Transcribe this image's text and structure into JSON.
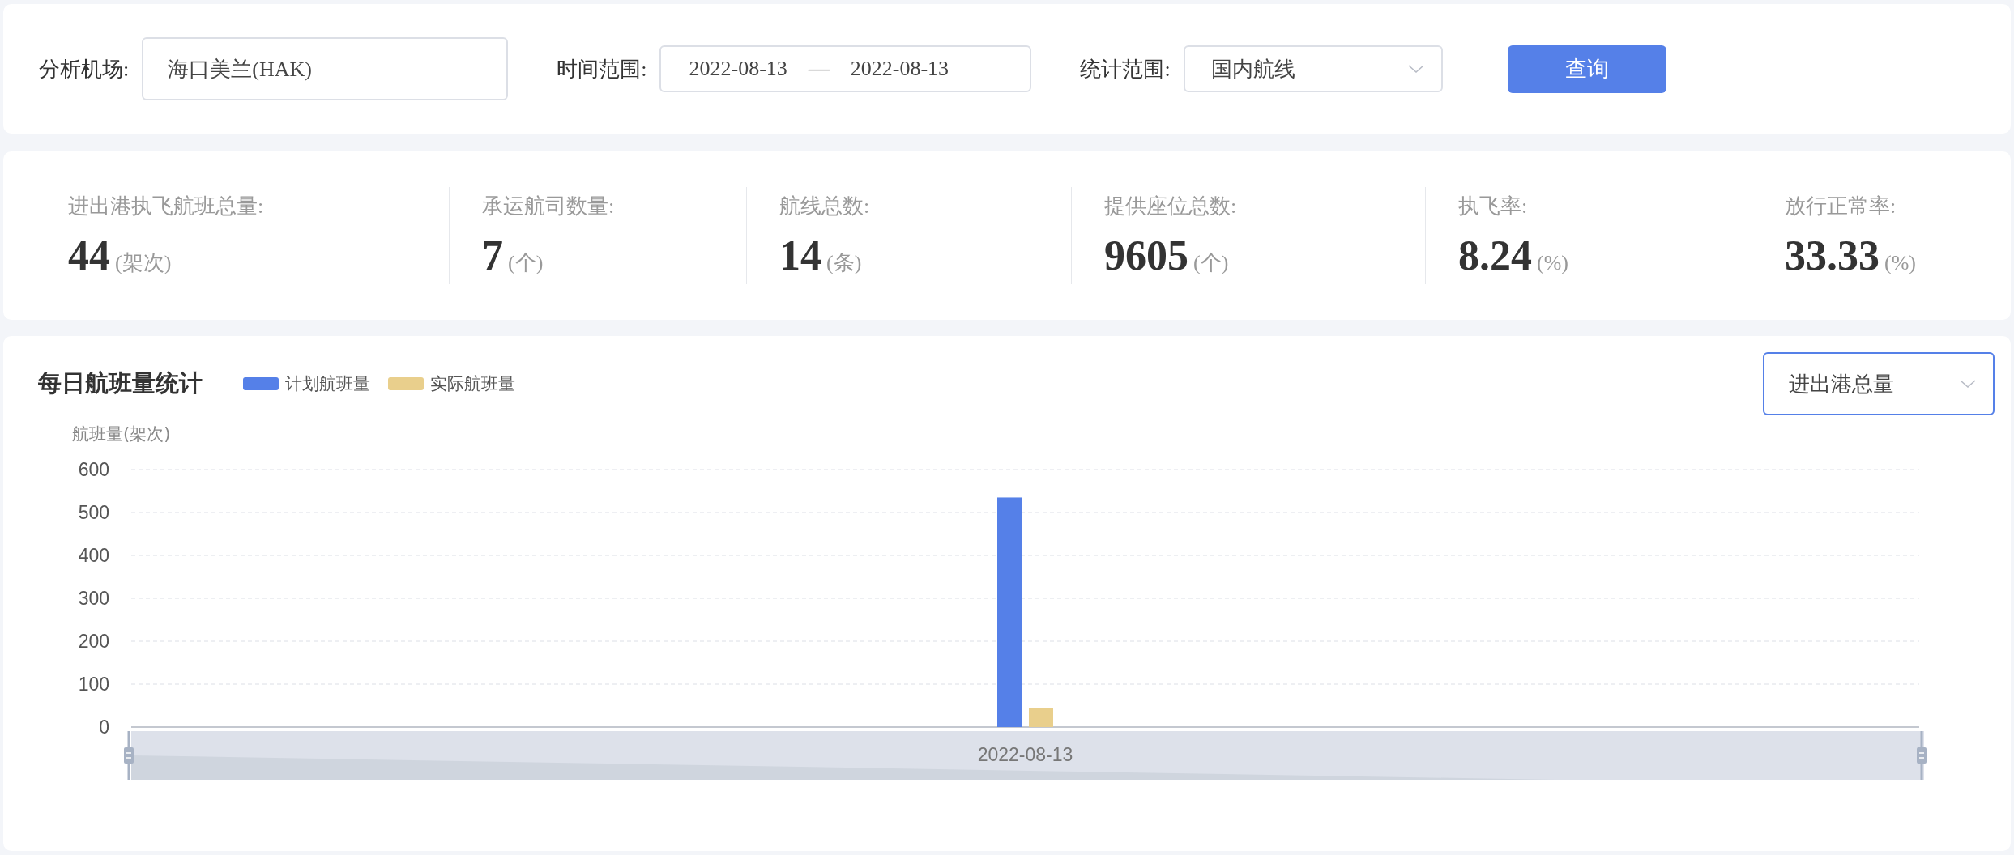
{
  "filters": {
    "airport": {
      "label": "分析机场:",
      "value": "海口美兰(HAK)"
    },
    "time_range": {
      "label": "时间范围:",
      "start": "2022-08-13",
      "separator": "—",
      "end": "2022-08-13"
    },
    "scope": {
      "label": "统计范围:",
      "value": "国内航线"
    },
    "query_button": "查询"
  },
  "stats": [
    {
      "label": "进出港执飞航班总量:",
      "value": "44",
      "unit": "(架次)"
    },
    {
      "label": "承运航司数量:",
      "value": "7",
      "unit": "(个)"
    },
    {
      "label": "航线总数:",
      "value": "14",
      "unit": "(条)"
    },
    {
      "label": "提供座位总数:",
      "value": "9605",
      "unit": "(个)"
    },
    {
      "label": "执飞率:",
      "value": "8.24",
      "unit": "(%)"
    },
    {
      "label": "放行正常率:",
      "value": "33.33",
      "unit": "(%)"
    }
  ],
  "chart_panel": {
    "title": "每日航班量统计",
    "dropdown": "进出港总量",
    "zoom_label": "2022-08-13",
    "chart_data": {
      "type": "bar",
      "grid": true,
      "ylabel": "航班量(架次)",
      "categories": [
        "2022-08-13"
      ],
      "series": [
        {
          "name": "计划航班量",
          "color": "#5580e8",
          "values": [
            535
          ]
        },
        {
          "name": "实际航班量",
          "color": "#e9cf8c",
          "values": [
            44
          ]
        }
      ],
      "ylim": [
        0,
        600
      ],
      "yticks": [
        0,
        100,
        200,
        300,
        400,
        500,
        600
      ]
    }
  }
}
